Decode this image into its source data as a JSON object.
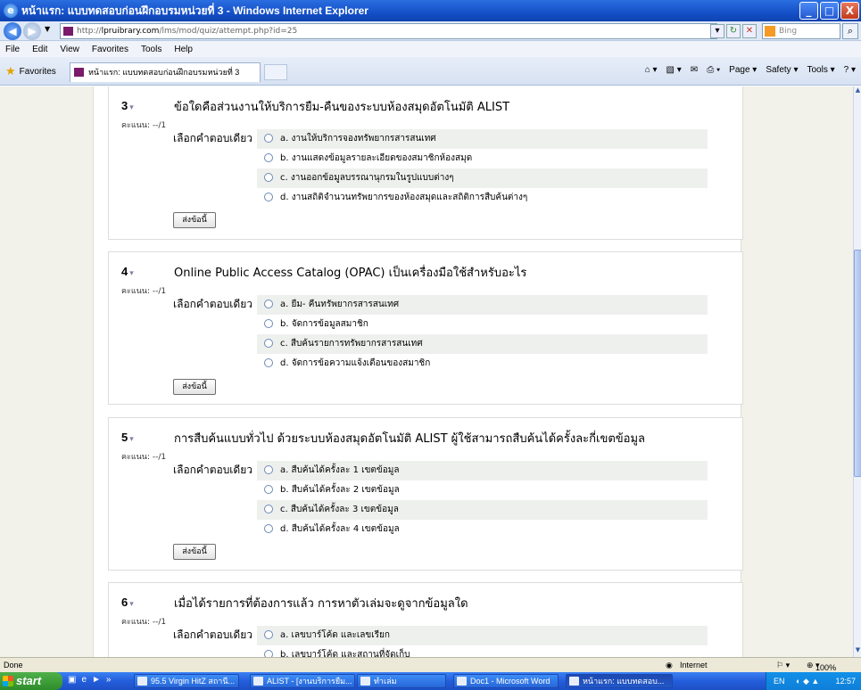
{
  "window": {
    "title": "หน้าแรก: แบบทดสอบก่อนฝึกอบรมหน่วยที่ 3 - Windows Internet Explorer",
    "buttons": [
      "_",
      "□",
      "X"
    ]
  },
  "address": {
    "url_prefix": "http://",
    "url_host": "lpruibrary.com",
    "url_path": "/lms/mod/quiz/attempt.php?id=25",
    "search_placeholder": "Bing"
  },
  "menu": [
    "File",
    "Edit",
    "View",
    "Favorites",
    "Tools",
    "Help"
  ],
  "favorites": {
    "label": "Favorites",
    "tab_title": "หน้าแรก: แบบทดสอบก่อนฝึกอบรมหน่วยที่ 3",
    "commands": [
      "Page ▾",
      "Safety ▾",
      "Tools ▾"
    ]
  },
  "quiz": {
    "score_label": "คะแนน: --/1",
    "answer_label": "เลือกคำตอบเดียว",
    "submit_label": "ส่งข้อนี้",
    "questions": [
      {
        "number": "3",
        "text": "ข้อใดคือส่วนงานให้บริการยืม-คืนของระบบห้องสมุดอัตโนมัติ ALIST",
        "answers": [
          "a. งานให้บริการจองทรัพยากรสารสนเทศ",
          "b. งานแสดงข้อมูลรายละเอียดของสมาชิกห้องสมุด",
          "c. งานออกข้อมูลบรรณานุกรมในรูปแบบต่างๆ",
          "d. งานสถิติจำนวนทรัพยากรของห้องสมุดและสถิติการสืบค้นต่างๆ"
        ]
      },
      {
        "number": "4",
        "text": "Online Public Access Catalog (OPAC) เป็นเครื่องมือใช้สำหรับอะไร",
        "answers": [
          "a. ยืม- คืนทรัพยากรสารสนเทศ",
          "b. จัดการข้อมูลสมาชิก",
          "c. สืบค้นรายการทรัพยากรสารสนเทศ",
          "d. จัดการข้อความแจ้งเตือนของสมาชิก"
        ]
      },
      {
        "number": "5",
        "text": "การสืบค้นแบบทั่วไป ด้วยระบบห้องสมุดอัตโนมัติ ALIST ผู้ใช้สามารถสืบค้นได้ครั้งละกี่เขตข้อมูล",
        "answers": [
          "a. สืบค้นได้ครั้งละ 1 เขตข้อมูล",
          "b. สืบค้นได้ครั้งละ 2 เขตข้อมูล",
          "c. สืบค้นได้ครั้งละ 3 เขตข้อมูล",
          "d. สืบค้นได้ครั้งละ 4 เขตข้อมูล"
        ]
      },
      {
        "number": "6",
        "text": "เมื่อได้รายการที่ต้องการแล้ว การหาตัวเล่มจะดูจากข้อมูลใด",
        "answers": [
          "a. เลขบาร์โค้ด และเลขเรียก",
          "b. เลขบาร์โค้ด และสถานที่จัดเก็บ"
        ]
      }
    ]
  },
  "status": {
    "left": "Done",
    "zone": "Internet",
    "zoom": "100%"
  },
  "taskbar": {
    "start": "start",
    "tasks": [
      "95.5 Virgin HitZ สถานี...",
      "ALIST - [งานบริการยืม...",
      "ทำเล่ม",
      "Doc1 - Microsoft Word",
      "หน้าแรก: แบบทดสอบ..."
    ],
    "tray_lang": "EN",
    "clock": "12:57"
  }
}
